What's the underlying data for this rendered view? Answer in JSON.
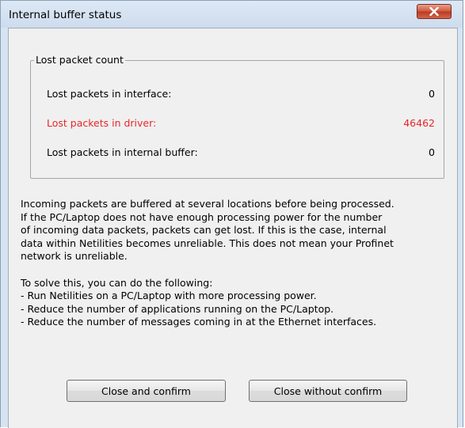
{
  "window": {
    "title": "Internal buffer status"
  },
  "group": {
    "legend": "Lost packet count",
    "rows": [
      {
        "label": "Lost packets in interface:",
        "value": "0"
      },
      {
        "label": "Lost packets in driver:",
        "value": "46462"
      },
      {
        "label": "Lost packets in internal buffer:",
        "value": "0"
      }
    ]
  },
  "info": {
    "paragraph1": [
      "Incoming packets are buffered at several locations before being processed.",
      "If the PC/Laptop does not have enough processing power for the number",
      "of incoming data packets, packets can get lost. If this is the case, internal",
      "data within Netilities becomes unreliable. This does not mean your Profinet",
      "network is unreliable."
    ],
    "paragraph2": [
      "To solve this, you can do the following:",
      "- Run Netilities on a PC/Laptop with more processing power.",
      "- Reduce the number of applications running on the PC/Laptop.",
      "- Reduce the number of messages coming in at the Ethernet interfaces."
    ]
  },
  "buttons": {
    "confirm": "Close and confirm",
    "no_confirm": "Close without confirm"
  },
  "colors": {
    "alert": "#e8262a",
    "close_button": "#c94a30",
    "frame": "#d6e3f2"
  }
}
